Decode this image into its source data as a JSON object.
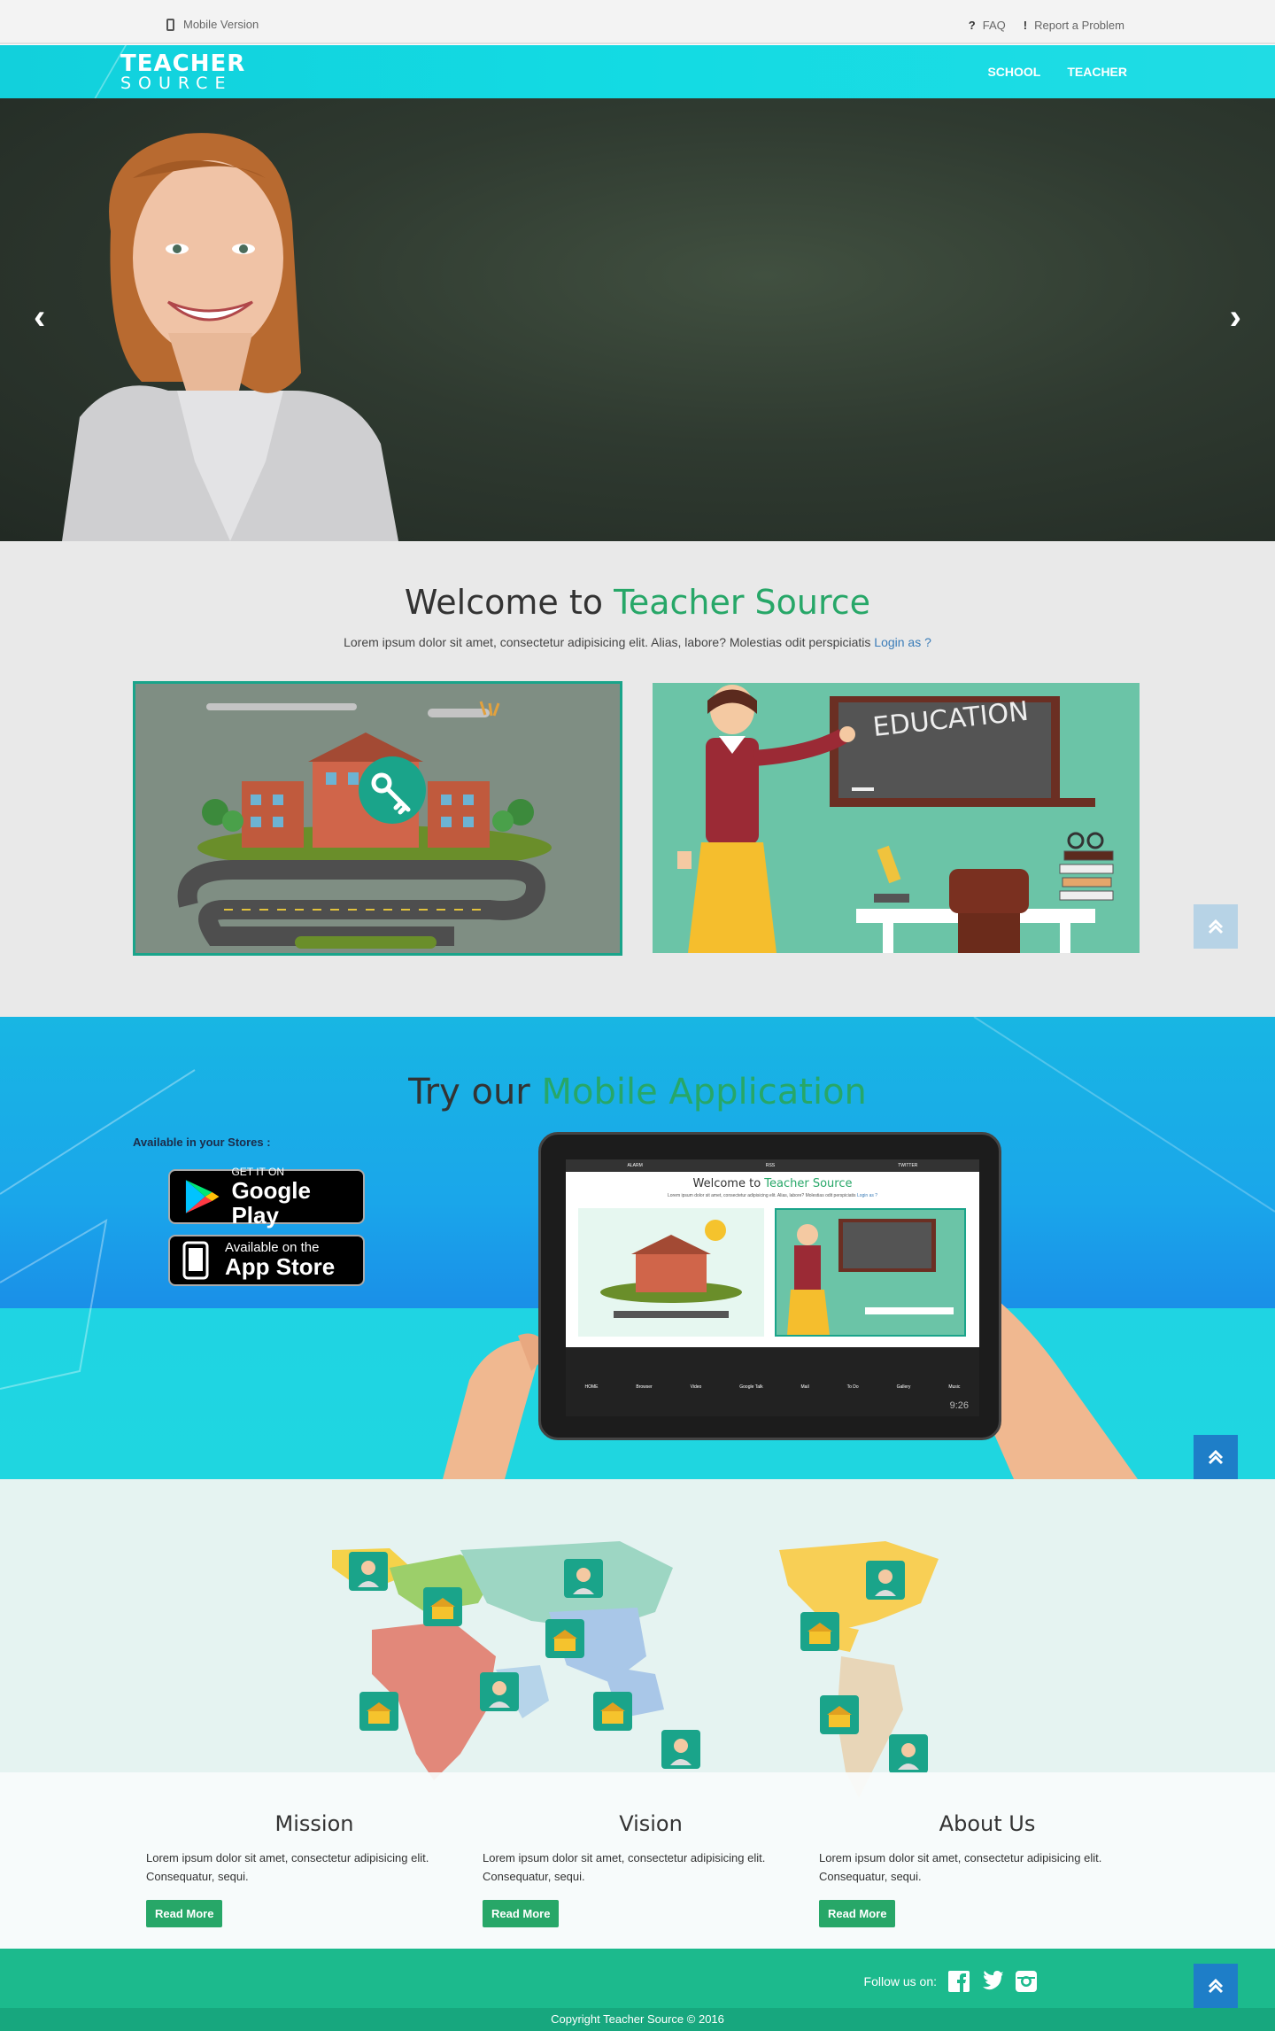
{
  "topbar": {
    "mobile_version": "Mobile Version",
    "faq": "FAQ",
    "report": "Report a Problem"
  },
  "navbar": {
    "logo_line1": "TEACHER",
    "logo_line2": "SOURCE",
    "links": [
      "SCHOOL",
      "TEACHER"
    ]
  },
  "hero": {
    "prev_icon": "chevron-left-icon",
    "next_icon": "chevron-right-icon"
  },
  "welcome": {
    "title_part1": "Welcome to ",
    "title_part2": "Teacher Source",
    "subtitle": "Lorem ipsum dolor sit amet, consectetur adipisicing elit. Alias, labore? Molestias odit perspiciatis",
    "login_link": "Login as ?",
    "chalkboard_text": "EDUCATION"
  },
  "mobile_app": {
    "title_part1": "Try our ",
    "title_part2": "Mobile Application",
    "stores_label": "Available in your Stores :",
    "google_play": {
      "line1": "GET IT ON",
      "line2": "Google Play"
    },
    "app_store": {
      "line1": "Available on the",
      "line2": "App Store"
    },
    "tablet": {
      "title_part1": "Welcome to ",
      "title_part2": "Teacher Source",
      "subtitle": "Lorem ipsum dolor sit amet, consectetur adipisicing elit. Alias, labore? Molestias odit perspiciatis",
      "login_link": "Login as ?",
      "tabs": [
        "ALARM",
        "RSS",
        "TWITTER"
      ],
      "dock": [
        "HOME",
        "Browser",
        "Video",
        "Google Talk",
        "Mail",
        "To Do",
        "Gallery",
        "Music"
      ],
      "time": "9:26"
    }
  },
  "info": {
    "columns": [
      {
        "title": "Mission",
        "text": "Lorem ipsum dolor sit amet, consectetur adipisicing elit. Consequatur, sequi.",
        "button": "Read More"
      },
      {
        "title": "Vision",
        "text": "Lorem ipsum dolor sit amet, consectetur adipisicing elit. Consequatur, sequi.",
        "button": "Read More"
      },
      {
        "title": "About Us",
        "text": "Lorem ipsum dolor sit amet, consectetur adipisicing elit. Consequatur, sequi.",
        "button": "Read More"
      }
    ]
  },
  "footer": {
    "follow": "Follow us on:",
    "social": [
      "facebook-icon",
      "twitter-icon",
      "instagram-icon"
    ],
    "copyright": "Copyright Teacher Source © 2016"
  },
  "colors": {
    "accent": "#13d6e0",
    "green": "#27a768",
    "footer": "#1cba8d",
    "link": "#3a7cb8",
    "scroll_button": "#1e7ec8"
  }
}
